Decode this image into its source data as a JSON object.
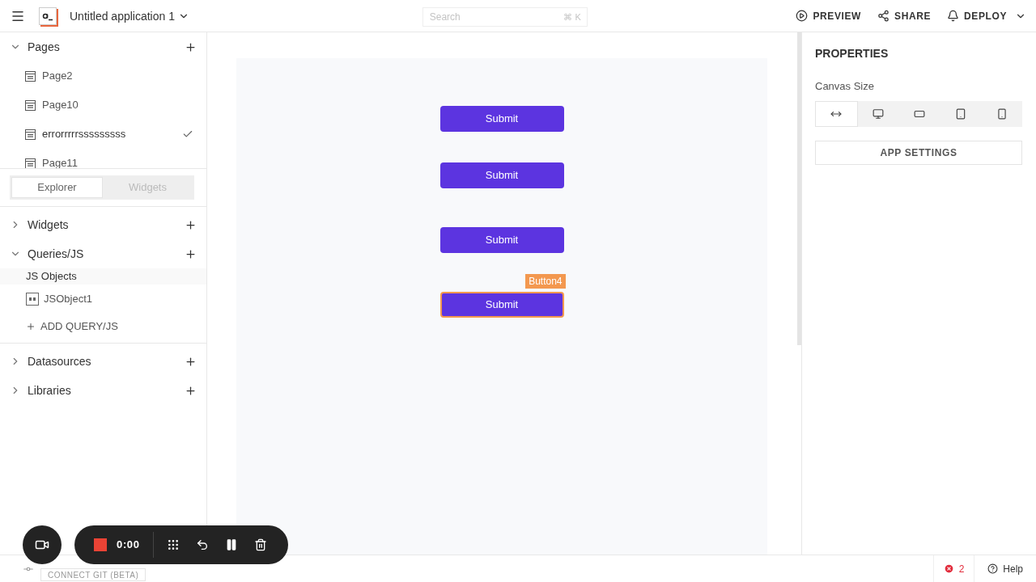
{
  "app": {
    "title": "Untitled application 1"
  },
  "search": {
    "placeholder": "Search",
    "shortcut": "⌘ K"
  },
  "actions": [
    {
      "label": "PREVIEW",
      "kind": "preview"
    },
    {
      "label": "SHARE",
      "kind": "share"
    },
    {
      "label": "DEPLOY",
      "kind": "deploy"
    }
  ],
  "pages": {
    "title": "Pages",
    "expanded": true,
    "items": [
      {
        "label": "Page2",
        "selected": false
      },
      {
        "label": "Page10",
        "selected": false
      },
      {
        "label": "errorrrrrsssssssss",
        "selected": true
      },
      {
        "label": "Page11",
        "selected": false
      }
    ]
  },
  "tabs": [
    {
      "label": "Explorer",
      "selected": true
    },
    {
      "label": "Widgets",
      "selected": false
    }
  ],
  "sections": [
    {
      "label": "Widgets",
      "expanded": false
    },
    {
      "label": "Queries/JS",
      "expanded": true,
      "group": "JS Objects",
      "items": [
        "JSObject1"
      ],
      "add": "ADD QUERY/JS"
    },
    {
      "label": "Datasources",
      "expanded": false
    },
    {
      "label": "Libraries",
      "expanded": false
    }
  ],
  "canvas": {
    "widgets": [
      {
        "label": "Submit",
        "selected": false
      },
      {
        "label": "Submit",
        "selected": false
      },
      {
        "label": "Submit",
        "selected": false
      },
      {
        "label": "Submit",
        "selected": true,
        "tag": "Button4"
      }
    ]
  },
  "properties": {
    "title": "PROPERTIES",
    "canvas_size": "Canvas Size",
    "sizes": [
      {
        "kind": "fluid",
        "selected": true
      },
      {
        "kind": "desktop",
        "selected": false
      },
      {
        "kind": "tablet-landscape",
        "selected": false
      },
      {
        "kind": "tablet",
        "selected": false
      },
      {
        "kind": "mobile",
        "selected": false
      }
    ],
    "settings": "APP SETTINGS"
  },
  "recorder": {
    "time": "0:00"
  },
  "status_bar": {
    "git": "CONNECT GIT (BETA)",
    "errors": "2",
    "help": "Help"
  }
}
